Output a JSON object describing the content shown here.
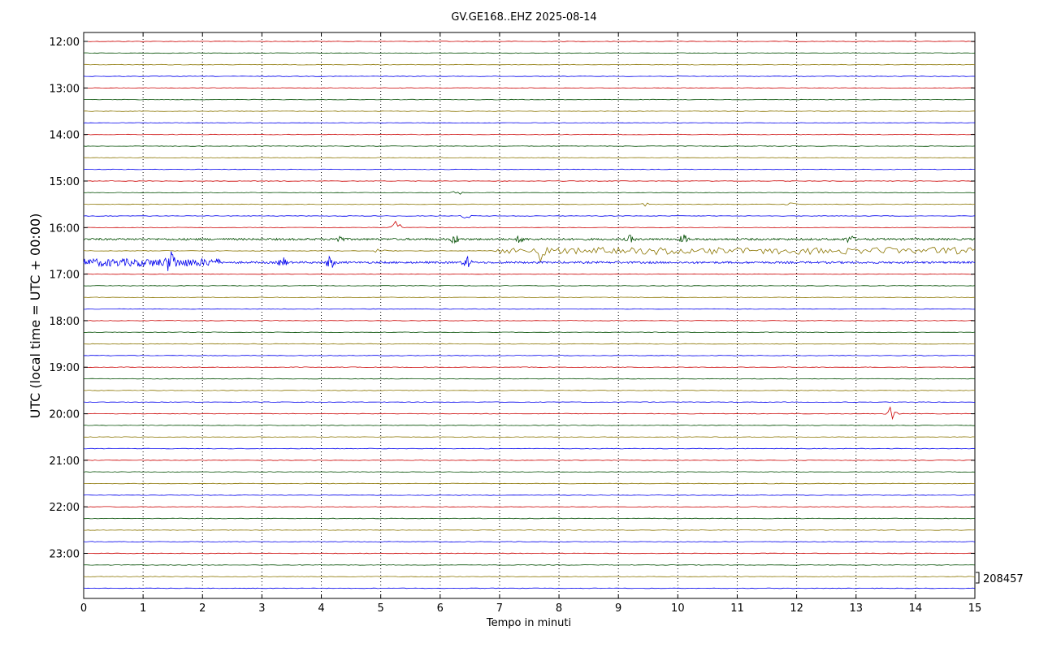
{
  "chart_data": {
    "type": "line",
    "title": "GV.GE168..EHZ 2025-08-14",
    "xlabel": "Tempo in minuti",
    "ylabel": "UTC (local time = UTC + 00:00)",
    "xlim": [
      0,
      15
    ],
    "x_ticks": [
      "0",
      "1",
      "2",
      "3",
      "4",
      "5",
      "6",
      "7",
      "8",
      "9",
      "10",
      "11",
      "12",
      "13",
      "14",
      "15"
    ],
    "y_ticks": [
      "12:00",
      "13:00",
      "14:00",
      "15:00",
      "16:00",
      "17:00",
      "18:00",
      "19:00",
      "20:00",
      "21:00",
      "22:00",
      "23:00"
    ],
    "grid": "vertical dotted at each minute",
    "scale_label": "208457",
    "trace_colors": [
      "#cc0000",
      "#004d00",
      "#8b7500",
      "#0000ee"
    ],
    "trace_rows": [
      "12:00",
      "12:15",
      "12:30",
      "12:45",
      "13:00",
      "13:15",
      "13:30",
      "13:45",
      "14:00",
      "14:15",
      "14:30",
      "14:45",
      "15:00",
      "15:15",
      "15:30",
      "15:45",
      "16:00",
      "16:15",
      "16:30",
      "16:45",
      "17:00",
      "17:15",
      "17:30",
      "17:45",
      "18:00",
      "18:15",
      "18:30",
      "18:45",
      "19:00",
      "19:15",
      "19:30",
      "19:45",
      "20:00",
      "20:15",
      "20:30",
      "20:45",
      "21:00",
      "21:15",
      "21:30",
      "21:45",
      "22:00",
      "22:15",
      "22:30",
      "22:45",
      "23:00",
      "23:15",
      "23:30",
      "23:45"
    ],
    "activity": [
      {
        "row": "15:15",
        "minute": 6.27,
        "amplitude": 0.8
      },
      {
        "row": "15:30",
        "minute": 9.45,
        "amplitude": 0.5
      },
      {
        "row": "15:30",
        "minute": 11.9,
        "amplitude": 0.6
      },
      {
        "row": "15:45",
        "minute": 6.45,
        "amplitude": 0.7
      },
      {
        "row": "16:00",
        "minute": 5.27,
        "amplitude": 1.3
      },
      {
        "row": "16:15",
        "minute": 4.3,
        "amplitude": 0.6
      },
      {
        "row": "16:15",
        "minute": 6.25,
        "amplitude": 0.8
      },
      {
        "row": "16:15",
        "minute": 7.35,
        "amplitude": 0.6
      },
      {
        "row": "16:15",
        "minute": 9.2,
        "amplitude": 0.6
      },
      {
        "row": "16:15",
        "minute": 10.1,
        "amplitude": 0.7
      },
      {
        "row": "16:15",
        "minute": 12.9,
        "amplitude": 0.7
      },
      {
        "row": "16:30",
        "minute": 7.7,
        "amplitude": 2.0
      },
      {
        "row": "16:30",
        "minute": 5.0,
        "amplitude": 1.5
      },
      {
        "row": "16:45",
        "minute": 1.47,
        "amplitude": 1.8
      },
      {
        "row": "16:45",
        "minute": 3.35,
        "amplitude": 0.9
      },
      {
        "row": "16:45",
        "minute": 4.15,
        "amplitude": 1.1
      },
      {
        "row": "16:45",
        "minute": 6.45,
        "amplitude": 1.0
      },
      {
        "row": "20:00",
        "minute": 13.6,
        "amplitude": 2.0
      }
    ]
  }
}
